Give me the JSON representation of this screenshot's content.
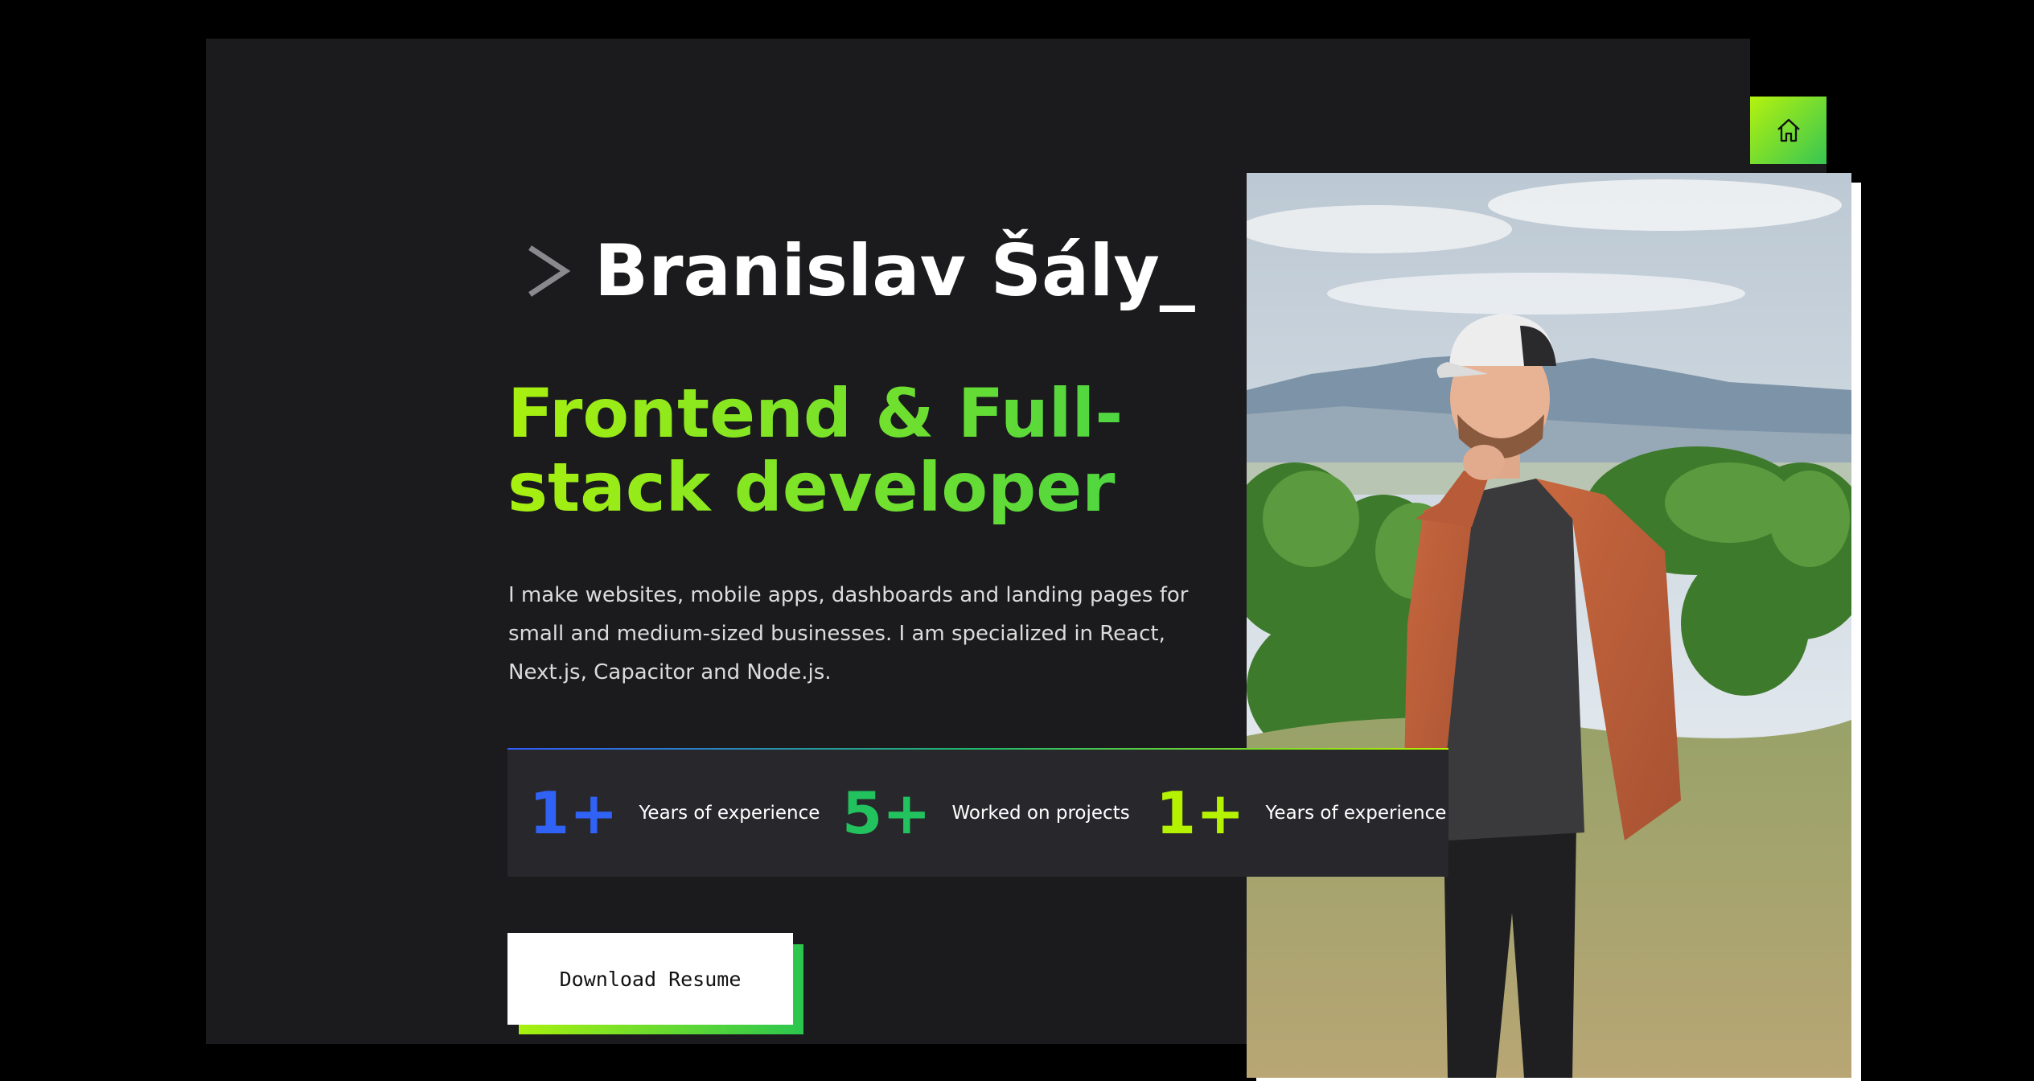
{
  "hero": {
    "name": "Branislav Šály_",
    "headline": "Frontend & Full-stack developer",
    "intro": "I make websites, mobile apps, dashboards and landing pages for small and medium-sized businesses. I am specialized in React, Next.js, Capacitor and Node.js."
  },
  "stats": [
    {
      "number": "1+",
      "label": "Years of experience",
      "color": "#2f62f5"
    },
    {
      "number": "5+",
      "label": "Worked on projects",
      "color": "#22c35e"
    },
    {
      "number": "1+",
      "label": "Years of experience",
      "color": "#b5f200"
    }
  ],
  "actions": {
    "download_label": "Download Resume"
  },
  "nav": {
    "items": [
      {
        "icon": "home-icon",
        "active": true
      },
      {
        "icon": "user-icon",
        "active": false
      },
      {
        "icon": "briefcase-icon",
        "active": false
      },
      {
        "icon": "mail-icon",
        "active": false
      }
    ],
    "social": [
      {
        "icon": "linkedin-icon"
      },
      {
        "icon": "github-icon"
      }
    ]
  },
  "theme": {
    "background": "#000000",
    "card": "#1b1b1e",
    "accent_green": "#a8f00f",
    "accent_green_dark": "#3fd14a"
  }
}
